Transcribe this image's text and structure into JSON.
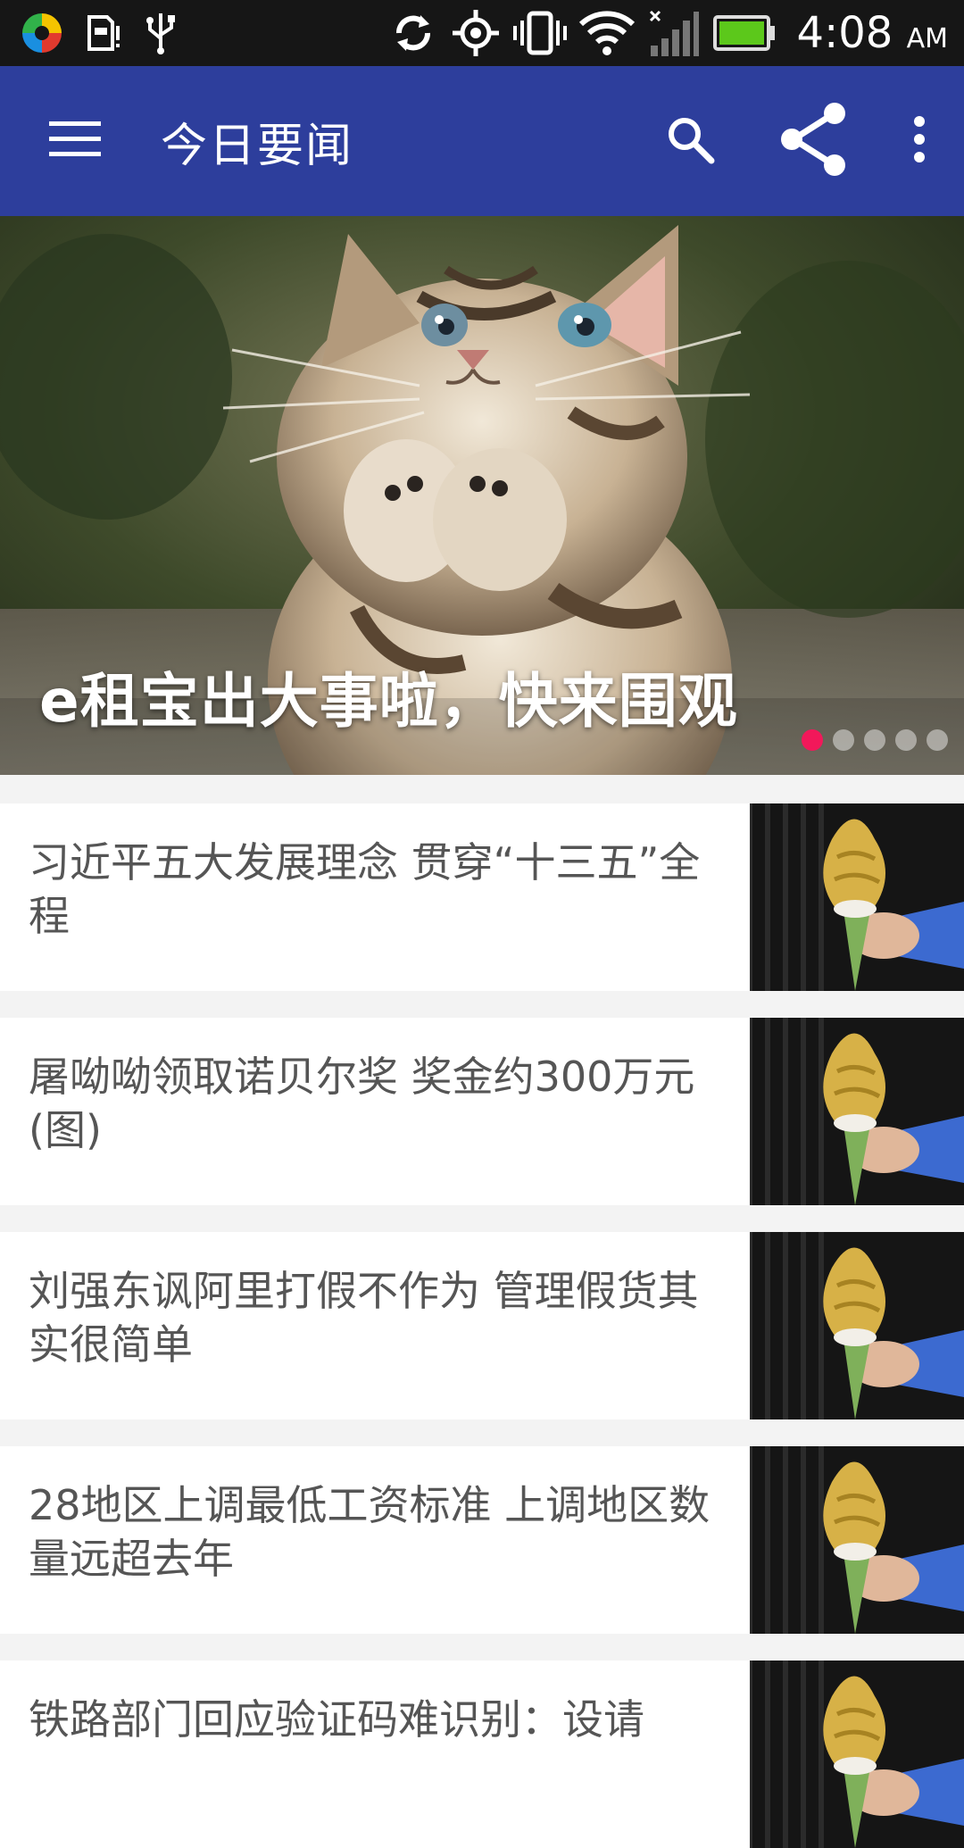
{
  "status_bar": {
    "time": "4:08",
    "ampm": "AM",
    "icons": [
      "app-logo-icon",
      "sim-alert-icon",
      "usb-icon",
      "sync-icon",
      "gps-icon",
      "vibrate-icon",
      "wifi-icon",
      "signal-icon",
      "battery-icon"
    ]
  },
  "app_bar": {
    "title": "今日要闻",
    "icons": [
      "menu-icon",
      "search-icon",
      "share-icon",
      "more-vert-icon"
    ],
    "color": "#2d3e9c"
  },
  "banner": {
    "caption": "e租宝出大事啦，快来围观",
    "slide_count": 5,
    "active_slide": 1,
    "indicator_color": "#f2185a"
  },
  "news": [
    {
      "title": "习近平五大发展理念 贯穿“十三五”全程"
    },
    {
      "title": "屠呦呦领取诺贝尔奖 奖金约300万元(图)"
    },
    {
      "title": "刘强东讽阿里打假不作为 管理假货其实很简单"
    },
    {
      "title": "28地区上调最低工资标准 上调地区数量远超去年"
    },
    {
      "title": "铁路部门回应验证码难识别：设请"
    }
  ]
}
